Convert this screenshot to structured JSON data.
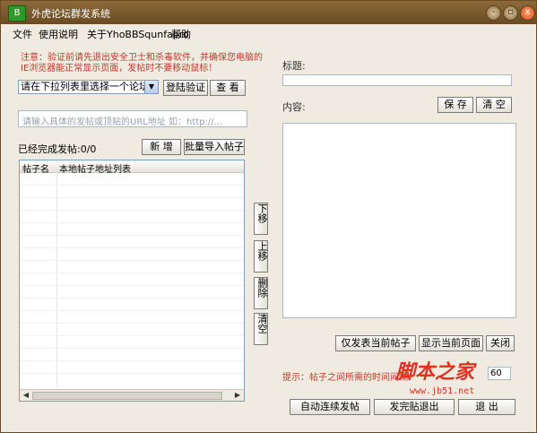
{
  "window": {
    "title": "外虎论坛群发系统",
    "controls": {
      "minimize": "-",
      "restore": "▫",
      "close": "x"
    }
  },
  "menu": [
    "文件",
    "使用说明",
    "关于YhoBBSqunfapro",
    "帮助"
  ],
  "left": {
    "notice": "注意：验证前请先退出安全卫士和杀毒软件，并确保您电脑的IE浏览器能正常显示页面，发帖时不要移动鼠标！",
    "forum_select": {
      "value": "请在下拉列表里选择一个论坛"
    },
    "verify_button": "登陆验证",
    "view_button": "查 看",
    "url_input": {
      "placeholder": "请输入具体的发帖或顶贴的URL地址 如：http://..."
    },
    "completed_label": "已经完成发帖:0/0",
    "add_button": "新 增",
    "import_button": "批量导入帖子",
    "table": {
      "headers": [
        "帖子名",
        "本地帖子地址列表"
      ],
      "rows": []
    },
    "side_buttons": [
      "下移",
      "上移",
      "删除",
      "清空"
    ]
  },
  "right": {
    "title_label": "标题:",
    "title_input": {
      "value": ""
    },
    "content_label": "内容:",
    "save_button": "保 存",
    "clear_button": "清 空",
    "content": "",
    "publish_current_button": "仅发表当前帖子",
    "show_page_button": "显示当前页面",
    "close_button": "关闭",
    "tip": "提示：帖子之间所需的时间间隔",
    "interval_value": "60",
    "auto_publish_button": "自动连续发帖",
    "quit_after_button": "发完贴退出",
    "exit_button": "退 出"
  },
  "watermark": {
    "text": "脚本之家",
    "url": "www.jb51.net"
  }
}
